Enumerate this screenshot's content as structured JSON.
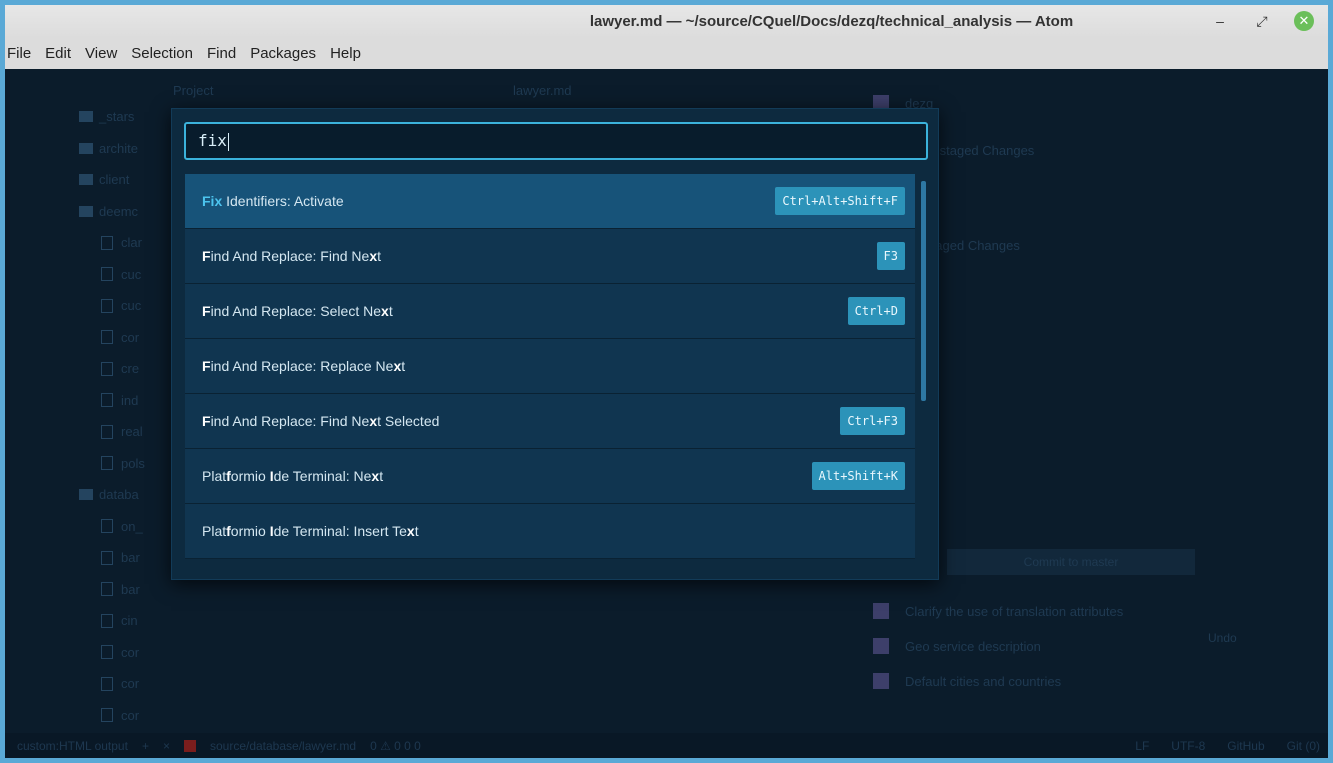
{
  "window": {
    "title": "lawyer.md — ~/source/CQuel/Docs/dezq/technical_analysis — Atom",
    "controls": {
      "minimize": "–",
      "restore": "⤢",
      "close": "✕"
    }
  },
  "menu": [
    "File",
    "Edit",
    "View",
    "Selection",
    "Find",
    "Packages",
    "Help"
  ],
  "background": {
    "project_label": "Project",
    "tab_label": "lawyer.md",
    "tree": [
      {
        "type": "folder",
        "label": "_stars"
      },
      {
        "type": "folder",
        "label": "archite"
      },
      {
        "type": "folder",
        "label": "client"
      },
      {
        "type": "folder",
        "label": "deemc"
      },
      {
        "type": "file",
        "label": "clar"
      },
      {
        "type": "file",
        "label": "cuc"
      },
      {
        "type": "file",
        "label": "cuc"
      },
      {
        "type": "file",
        "label": "cor"
      },
      {
        "type": "file",
        "label": "cre"
      },
      {
        "type": "file",
        "label": "ind"
      },
      {
        "type": "file",
        "label": "real"
      },
      {
        "type": "file",
        "label": "pols"
      },
      {
        "type": "folder",
        "label": "databa"
      },
      {
        "type": "file",
        "label": "on_"
      },
      {
        "type": "file",
        "label": "bar"
      },
      {
        "type": "file",
        "label": "bar"
      },
      {
        "type": "file",
        "label": "cin"
      },
      {
        "type": "file",
        "label": "cor"
      },
      {
        "type": "file",
        "label": "cor"
      },
      {
        "type": "file",
        "label": "cor"
      }
    ],
    "git_panel": {
      "repo": "dezq",
      "unstaged": "Unstaged Changes",
      "staged": "Staged Changes",
      "commit_button": "Commit to master",
      "undo": "Undo",
      "commits": [
        "Clarify the use of translation attributes",
        "Geo service description",
        "Default cities and countries"
      ]
    }
  },
  "status_bar": {
    "left": [
      "custom:HTML output",
      "+",
      "×",
      "source/database/lawyer.md",
      "0 ⚠ 0 0 0"
    ],
    "right": [
      "LF",
      "UTF-8",
      "GitHub",
      "Git (0)"
    ]
  },
  "palette": {
    "query": "fix",
    "results": [
      {
        "segments": [
          [
            "Fix",
            "first"
          ],
          [
            " Identifiers: Activate",
            ""
          ]
        ],
        "keybinding": "Ctrl+Alt+Shift+F",
        "selected": true
      },
      {
        "segments": [
          [
            "F",
            "hl"
          ],
          [
            "ind And Replace: Find Ne",
            ""
          ],
          [
            "x",
            "hl"
          ],
          [
            "t",
            ""
          ]
        ],
        "keybinding": "F3",
        "selected": false
      },
      {
        "segments": [
          [
            "F",
            "hl"
          ],
          [
            "ind And Replace: Select Ne",
            ""
          ],
          [
            "x",
            "hl"
          ],
          [
            "t",
            ""
          ]
        ],
        "keybinding": "Ctrl+D",
        "selected": false
      },
      {
        "segments": [
          [
            "F",
            "hl"
          ],
          [
            "ind And Replace: Replace Ne",
            ""
          ],
          [
            "x",
            "hl"
          ],
          [
            "t",
            ""
          ]
        ],
        "keybinding": "",
        "selected": false
      },
      {
        "segments": [
          [
            "F",
            "hl"
          ],
          [
            "ind And Replace: Find Ne",
            ""
          ],
          [
            "x",
            "hl"
          ],
          [
            "t Selected",
            ""
          ]
        ],
        "keybinding": "Ctrl+F3",
        "selected": false
      },
      {
        "segments": [
          [
            "Plat",
            ""
          ],
          [
            "f",
            "hl"
          ],
          [
            "ormio ",
            ""
          ],
          [
            "I",
            "hl"
          ],
          [
            "de Terminal: Ne",
            ""
          ],
          [
            "x",
            "hl"
          ],
          [
            "t",
            ""
          ]
        ],
        "keybinding": "Alt+Shift+K",
        "selected": false
      },
      {
        "segments": [
          [
            "Plat",
            ""
          ],
          [
            "f",
            "hl"
          ],
          [
            "ormio ",
            ""
          ],
          [
            "I",
            "hl"
          ],
          [
            "de Terminal: Insert Te",
            ""
          ],
          [
            "x",
            "hl"
          ],
          [
            "t",
            ""
          ]
        ],
        "keybinding": "",
        "selected": false
      }
    ]
  },
  "colors": {
    "accent": "#3bb2db",
    "selected_row": "#175379",
    "row": "#103550",
    "keybinding_bg": "#2c93b9"
  }
}
